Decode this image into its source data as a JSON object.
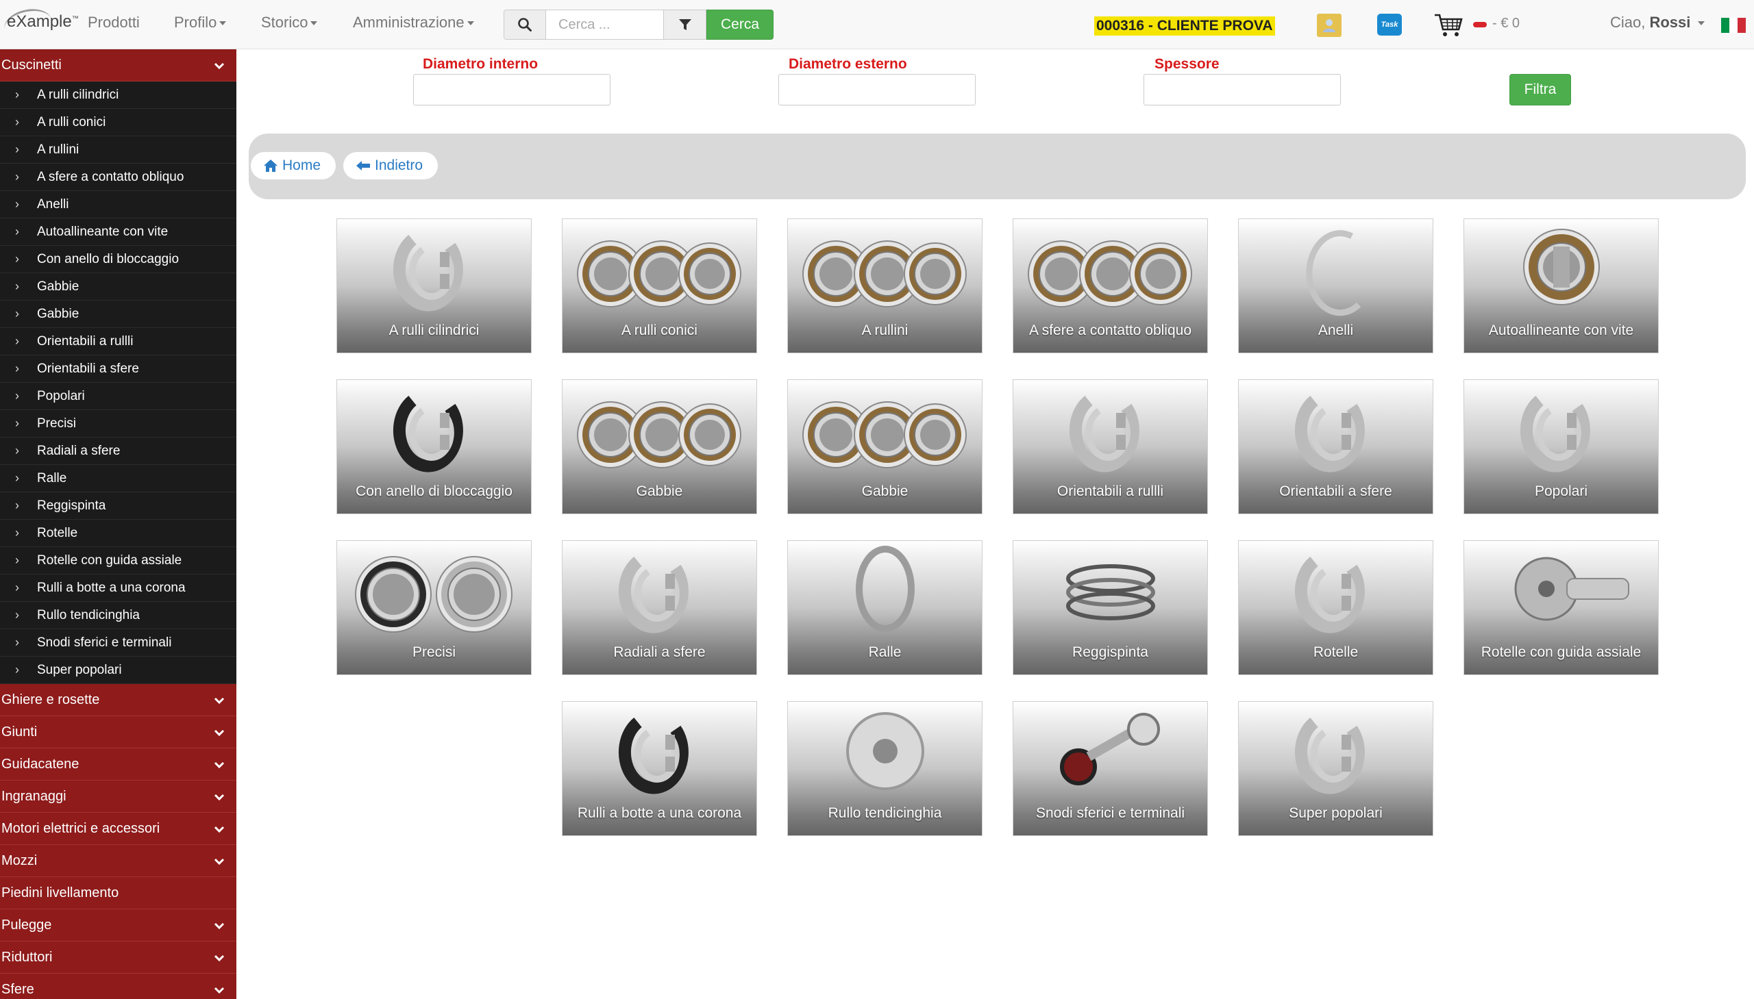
{
  "navbar": {
    "brand": "eXample",
    "menu": [
      {
        "label": "Prodotti",
        "caret": false
      },
      {
        "label": "Profilo",
        "caret": true
      },
      {
        "label": "Storico",
        "caret": true
      },
      {
        "label": "Amministrazione",
        "caret": true
      }
    ],
    "search_placeholder": "Cerca ...",
    "search_button": "Cerca",
    "client": "000316 - CLIENTE PROVA",
    "cart_total": "- € 0",
    "greeting_prefix": "Ciao,",
    "user_name": "Rossi",
    "flag_colors": [
      "#009246",
      "#ffffff",
      "#ce2b37"
    ]
  },
  "sidebar": {
    "open_category": "Cuscinetti",
    "sub_items": [
      "A rulli cilindrici",
      "A rulli conici",
      "A rullini",
      "A sfere a contatto obliquo",
      "Anelli",
      "Autoallineante con vite",
      "Con anello di bloccaggio",
      "Gabbie",
      "Gabbie",
      "Orientabili a rullli",
      "Orientabili a sfere",
      "Popolari",
      "Precisi",
      "Radiali a sfere",
      "Ralle",
      "Reggispinta",
      "Rotelle",
      "Rotelle con guida assiale",
      "Rulli a botte a una corona",
      "Rullo tendicinghia",
      "Snodi sferici e terminali",
      "Super popolari"
    ],
    "categories": [
      {
        "label": "Ghiere e rosette",
        "chevron": true
      },
      {
        "label": "Giunti",
        "chevron": true
      },
      {
        "label": "Guidacatene",
        "chevron": true
      },
      {
        "label": "Ingranaggi",
        "chevron": true
      },
      {
        "label": "Motori elettrici e accessori",
        "chevron": true
      },
      {
        "label": "Mozzi",
        "chevron": true
      },
      {
        "label": "Piedini livellamento",
        "chevron": false
      },
      {
        "label": "Pulegge",
        "chevron": true
      },
      {
        "label": "Riduttori",
        "chevron": true
      },
      {
        "label": "Sfere",
        "chevron": true
      }
    ],
    "colors": {
      "header": "#8f1b1b",
      "background": "#1b1b1b"
    }
  },
  "filters": {
    "diametro_interno": "Diametro interno",
    "diametro_esterno": "Diametro esterno",
    "spessore": "Spessore",
    "button": "Filtra"
  },
  "breadcrumb": {
    "home": "Home",
    "back": "Indietro"
  },
  "tiles": [
    {
      "label": "A rulli cilindrici",
      "icon": "cylindrical-roller-bearing-icon"
    },
    {
      "label": "A rulli conici",
      "icon": "tapered-roller-bearing-icon"
    },
    {
      "label": "A rullini",
      "icon": "needle-roller-bearing-icon"
    },
    {
      "label": "A sfere a contatto obliquo",
      "icon": "angular-contact-bearing-icon"
    },
    {
      "label": "Anelli",
      "icon": "ring-icon"
    },
    {
      "label": "Autoallineante con vite",
      "icon": "self-aligning-bearing-icon"
    },
    {
      "label": "Con anello di bloccaggio",
      "icon": "locking-collar-bearing-icon"
    },
    {
      "label": "Gabbie",
      "icon": "cage-bearing-icon"
    },
    {
      "label": "Gabbie",
      "icon": "cage-bearing-icon"
    },
    {
      "label": "Orientabili a rullli",
      "icon": "spherical-roller-bearing-icon"
    },
    {
      "label": "Orientabili a sfere",
      "icon": "self-aligning-ball-bearing-icon"
    },
    {
      "label": "Popolari",
      "icon": "popular-bearing-icon"
    },
    {
      "label": "Precisi",
      "icon": "precision-bearing-icon"
    },
    {
      "label": "Radiali a sfere",
      "icon": "radial-ball-bearing-icon"
    },
    {
      "label": "Ralle",
      "icon": "thrust-washer-icon"
    },
    {
      "label": "Reggispinta",
      "icon": "thrust-bearing-icon"
    },
    {
      "label": "Rotelle",
      "icon": "track-roller-icon"
    },
    {
      "label": "Rotelle con guida assiale",
      "icon": "stud-track-roller-icon"
    },
    {
      "label": "Rulli a botte a una corona",
      "icon": "barrel-roller-bearing-icon"
    },
    {
      "label": "Rullo tendicinghia",
      "icon": "belt-tensioner-icon"
    },
    {
      "label": "Snodi sferici e terminali",
      "icon": "rod-end-icon"
    },
    {
      "label": "Super popolari",
      "icon": "super-popular-bearing-icon"
    }
  ]
}
